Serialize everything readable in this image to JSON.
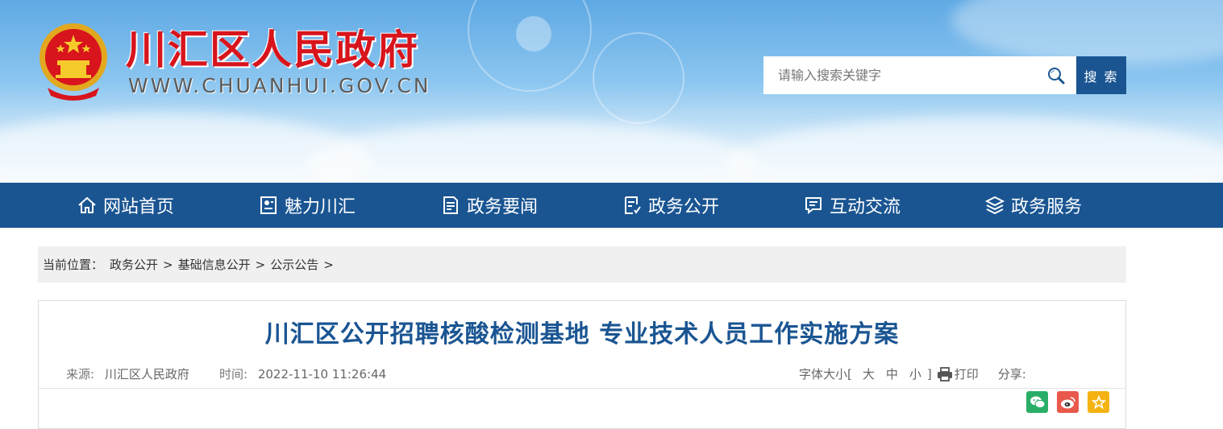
{
  "header": {
    "site_title": "川汇区人民政府",
    "site_url": "WWW.CHUANHUI.GOV.CN",
    "search_placeholder": "请输入搜索关键字",
    "search_button": "搜 索",
    "emblem_icon": "national-emblem-icon"
  },
  "nav": {
    "items": [
      {
        "label": "网站首页",
        "icon": "home-icon"
      },
      {
        "label": "魅力川汇",
        "icon": "profile-card-icon"
      },
      {
        "label": "政务要闻",
        "icon": "document-icon"
      },
      {
        "label": "政务公开",
        "icon": "checklist-icon"
      },
      {
        "label": "互动交流",
        "icon": "message-icon"
      },
      {
        "label": "政务服务",
        "icon": "layers-icon"
      }
    ]
  },
  "breadcrumb": {
    "label": "当前位置：",
    "items": [
      "政务公开",
      "基础信息公开",
      "公示公告"
    ],
    "sep": ">"
  },
  "article": {
    "title": "川汇区公开招聘核酸检测基地 专业技术人员工作实施方案",
    "source_label": "来源:",
    "source_value": "川汇区人民政府",
    "time_label": "时间:",
    "time_value": "2022-11-10 11:26:44",
    "font_size_label": "字体大小[",
    "font_large": "大",
    "font_medium": "中",
    "font_small": "小",
    "font_close": "]",
    "print_label": "打印",
    "share_label": "分享:",
    "share_icons": [
      "wechat-icon",
      "weibo-icon",
      "favorite-star-icon"
    ]
  },
  "colors": {
    "brand_blue": "#1a5592",
    "title_red": "#d8141c",
    "wechat_green": "#2aae67",
    "weibo_red": "#e8594c",
    "star_yellow": "#f4b312"
  }
}
